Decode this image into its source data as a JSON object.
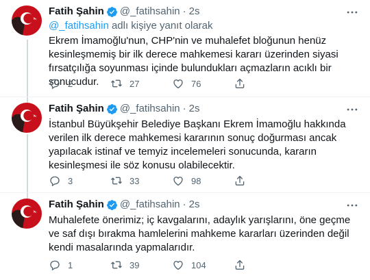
{
  "author": {
    "name": "Fatih Şahin",
    "handle": "@_fatihsahin",
    "time": "2s"
  },
  "colors": {
    "accent": "#1d9bf0",
    "secondary_text": "#536471",
    "avatar_red": "#e30a17"
  },
  "icons": {
    "verified": "verified-badge-icon",
    "more": "more-horizontal-icon",
    "reply": "reply-icon",
    "retweet": "retweet-icon",
    "like": "heart-icon",
    "share": "share-icon"
  },
  "tweets": [
    {
      "reply_to_link": "@_fatihsahin",
      "reply_to_suffix": " adlı kişiye yanıt olarak",
      "text": "Ekrem İmamoğlu'nun, CHP'nin ve muhalefet bloğunun henüz kesinleşmemiş bir ilk derece mahkemesi kararı üzerinden siyasi fırsatçılığa soyunması içinde bulundukları açmazların acıklı bir sonucudur.",
      "replies": "2",
      "retweets": "27",
      "likes": "76"
    },
    {
      "text": "İstanbul Büyükşehir Belediye Başkanı Ekrem İmamoğlu hakkında verilen ilk derece mahkemesi kararının sonuç doğurması ancak yapılacak istinaf ve temyiz incelemeleri sonucunda, kararın kesinleşmesi ile söz konusu olabilecektir.",
      "replies": "3",
      "retweets": "33",
      "likes": "98"
    },
    {
      "text": "Muhalefete önerimiz; iç kavgalarını, adaylık yarışlarını, öne geçme ve saf dışı bırakma hamlelerini mahkeme kararları üzerinden değil kendi masalarında yapmalarıdır.",
      "replies": "1",
      "retweets": "39",
      "likes": "104"
    }
  ]
}
